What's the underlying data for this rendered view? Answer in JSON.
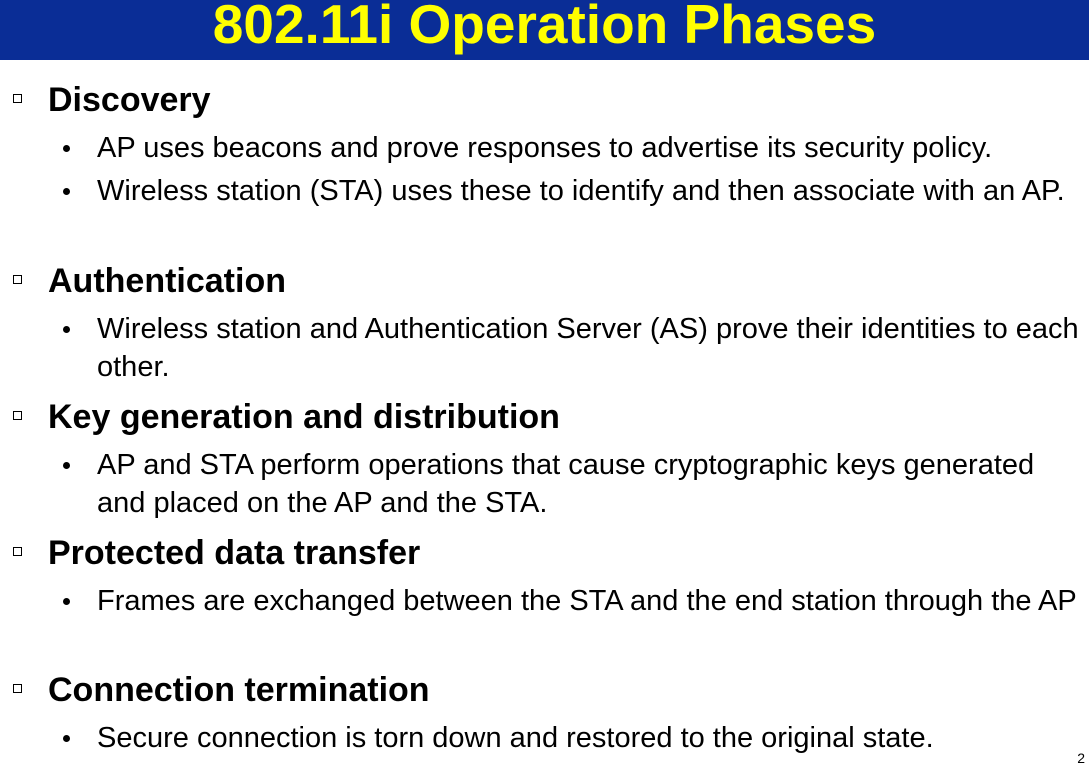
{
  "title": "802.11i Operation Phases",
  "sections": [
    {
      "heading": "Discovery",
      "bullets": [
        "AP uses beacons and prove responses to advertise its security policy.",
        "Wireless station (STA) uses these to identify and then associate with an AP."
      ]
    },
    {
      "heading": "Authentication",
      "bullets": [
        "Wireless station and Authentication Server (AS) prove their identities to each other."
      ]
    },
    {
      "heading": "Key generation and distribution",
      "bullets": [
        "AP and STA perform operations that cause cryptographic keys generated and placed on the AP and the STA."
      ]
    },
    {
      "heading": "Protected data transfer",
      "bullets": [
        "Frames are exchanged between the STA and the end station through the AP"
      ]
    },
    {
      "heading": "Connection termination",
      "bullets": [
        "Secure connection is torn down and restored to the original state."
      ]
    }
  ],
  "page_number": "2",
  "colors": {
    "title_bar": "#0a2d96",
    "title_text": "#ffff00",
    "body_text": "#000000"
  },
  "icons": {
    "section_marker": "square-checkbox-icon",
    "item_marker": "bullet-dot-icon"
  }
}
